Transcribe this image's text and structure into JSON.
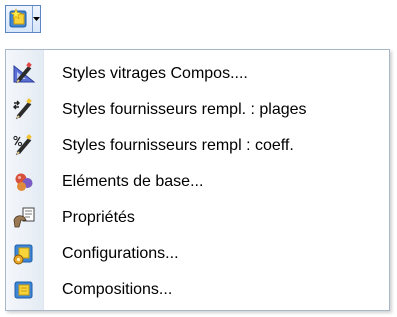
{
  "toolbar": {
    "button_icon": "yellow-document-star-icon",
    "dropdown_icon": "triangle-down-icon"
  },
  "menu": {
    "items": [
      {
        "label": "Styles vitrages Compos....",
        "icon": "pencil-ruler-icon"
      },
      {
        "label": "Styles fournisseurs rempl. : plages",
        "icon": "pencil-arrows-icon"
      },
      {
        "label": "Styles fournisseurs rempl : coeff.",
        "icon": "pencil-percent-icon"
      },
      {
        "label": "Eléments de base...",
        "icon": "colored-balls-icon"
      },
      {
        "label": "Propriétés",
        "icon": "properties-hand-icon"
      },
      {
        "label": "Configurations...",
        "icon": "gear-document-icon"
      },
      {
        "label": "Compositions...",
        "icon": "yellow-document-icon"
      }
    ]
  }
}
